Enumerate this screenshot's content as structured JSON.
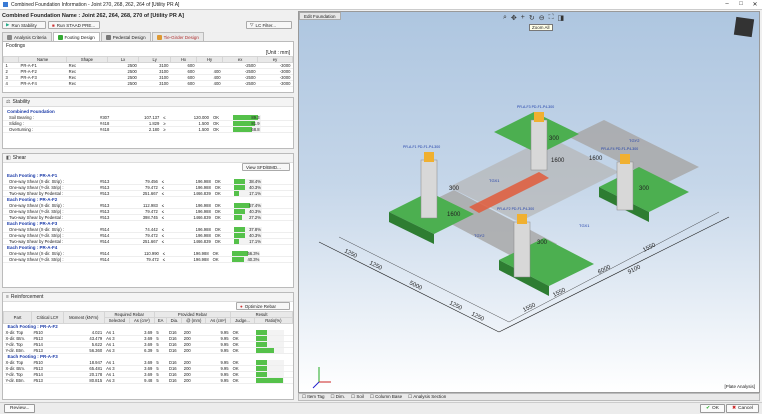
{
  "window": {
    "title": "Combined Foundation Information - Joint 270, 268, 262, 264 of [Utility PR A]"
  },
  "header": {
    "name": "Combined Foundation Name : Joint 262, 264, 268, 270 of [Utility PR A]"
  },
  "toolbar": {
    "run_stability": "Run Stability",
    "run_staad": "Run STAAD PRE...",
    "lc_filter": "LC Filter..."
  },
  "tabs": [
    "Analysis Criteria",
    "Footing Design",
    "Pedestal Design",
    "Tie-Girder Design"
  ],
  "footings": {
    "label": "Footings",
    "unit": "[Unit : mm]",
    "columns": [
      "",
      "Name",
      "Shape",
      "Lx",
      "Ly",
      "Hx",
      "Hy",
      "ex",
      "ey"
    ],
    "rows": [
      [
        "1",
        "PR-A-F1",
        "Rec",
        "2500",
        "3100",
        "600",
        "",
        "-2500",
        "-3000"
      ],
      [
        "2",
        "PR-A-F2",
        "Rec",
        "2500",
        "3100",
        "600",
        "400",
        "-2500",
        "-3000"
      ],
      [
        "3",
        "PR-A-F3",
        "Rec",
        "2500",
        "3100",
        "600",
        "400",
        "-2500",
        "-3000"
      ],
      [
        "4",
        "PR-A-F4",
        "Rec",
        "2500",
        "3100",
        "600",
        "400",
        "-2500",
        "-3000"
      ]
    ]
  },
  "stability": {
    "label": "Stability",
    "group": "Combined Foundation",
    "rows": [
      {
        "name": "Soil Bearing :",
        "lc": "#307",
        "val": "107.137",
        "op": "≤",
        "lim": "120.000",
        "st": "OK",
        "ratio": "89.3",
        "r": 0.893
      },
      {
        "name": "Sliding :",
        "lc": "#418",
        "val": "1.829",
        "op": "≥",
        "lim": "1.500",
        "st": "OK",
        "ratio": "81.9",
        "r": 0.819
      },
      {
        "name": "Overturning :",
        "lc": "#418",
        "val": "2.180",
        "op": "≥",
        "lim": "1.500",
        "st": "OK",
        "ratio": "68.8",
        "r": 0.688
      }
    ]
  },
  "shear": {
    "label": "Shear",
    "view_btn": "View SFD/BMD...",
    "groups": [
      {
        "title": "Each Footing : PR-A-F1",
        "rows": [
          {
            "name": "One-way Shear (X-dir. Strip) :",
            "lc": "#513",
            "val": "79.456",
            "op": "≤",
            "lim": "196.988",
            "st": "OK",
            "ratio": "38.4%",
            "r": 0.384
          },
          {
            "name": "One-way Shear (Y-dir. Strip) :",
            "lc": "#513",
            "val": "79.472",
            "op": "≤",
            "lim": "196.988",
            "st": "OK",
            "ratio": "40.3%",
            "r": 0.403
          },
          {
            "name": "Two-way Shear by Pedestal :",
            "lc": "#513",
            "val": "251.667",
            "op": "≤",
            "lim": "1466.839",
            "st": "OK",
            "ratio": "17.1%",
            "r": 0.171
          }
        ]
      },
      {
        "title": "Each Footing : PR-A-F2",
        "rows": [
          {
            "name": "One-way Shear (X-dir. Strip) :",
            "lc": "#513",
            "val": "112.983",
            "op": "≤",
            "lim": "196.988",
            "st": "OK",
            "ratio": "57.4%",
            "r": 0.574
          },
          {
            "name": "One-way Shear (Y-dir. Strip) :",
            "lc": "#513",
            "val": "79.472",
            "op": "≤",
            "lim": "196.988",
            "st": "OK",
            "ratio": "40.3%",
            "r": 0.403
          },
          {
            "name": "Two-way Shear by Pedestal :",
            "lc": "#513",
            "val": "398.745",
            "op": "≤",
            "lim": "1466.839",
            "st": "OK",
            "ratio": "27.2%",
            "r": 0.272
          }
        ]
      },
      {
        "title": "Each Footing : PR-A-F3",
        "rows": [
          {
            "name": "One-way Shear (X-dir. Strip) :",
            "lc": "#514",
            "val": "74.442",
            "op": "≤",
            "lim": "196.988",
            "st": "OK",
            "ratio": "37.8%",
            "r": 0.378
          },
          {
            "name": "One-way Shear (Y-dir. Strip) :",
            "lc": "#514",
            "val": "79.472",
            "op": "≤",
            "lim": "196.988",
            "st": "OK",
            "ratio": "40.3%",
            "r": 0.403
          },
          {
            "name": "Two-way Shear by Pedestal :",
            "lc": "#514",
            "val": "251.667",
            "op": "≤",
            "lim": "1466.839",
            "st": "OK",
            "ratio": "17.1%",
            "r": 0.171
          }
        ]
      },
      {
        "title": "Each Footing : PR-A-F4",
        "rows": [
          {
            "name": "One-way Shear (X-dir. Strip) :",
            "lc": "#514",
            "val": "110.990",
            "op": "≤",
            "lim": "196.988",
            "st": "OK",
            "ratio": "56.3%",
            "r": 0.563
          },
          {
            "name": "One-way Shear (Y-dir. Strip) :",
            "lc": "#514",
            "val": "79.472",
            "op": "≤",
            "lim": "196.988",
            "st": "OK",
            "ratio": "40.3%",
            "r": 0.403
          }
        ]
      }
    ]
  },
  "reinforcement": {
    "label": "Reinforcement",
    "optimize_btn": "Optimize Rebar",
    "head1": [
      "Part",
      "Critical LC#",
      "Moment (kN*m)",
      "Required Rebar",
      "Provided Rebar",
      "Result"
    ],
    "head2": [
      "Selected",
      "As (cm²)",
      "EA",
      "Dia.",
      "@ (mm)",
      "As (cm²)",
      "Judge...",
      "Ratio(%)"
    ],
    "groups": [
      {
        "title": "Each Footing : PR-A-F2",
        "rows": [
          {
            "part": "X-dir. Top",
            "lc": "#510",
            "m": "4.021",
            "sel": "As 1",
            "as": "3.69",
            "ea": "5",
            "dia": "D16",
            "at": "200",
            "pas": "9.95",
            "j": "OK",
            "r": 0.37
          },
          {
            "part": "X-dir. Btm.",
            "lc": "#513",
            "m": "43.479",
            "sel": "As 3",
            "as": "3.69",
            "ea": "5",
            "dia": "D16",
            "at": "200",
            "pas": "9.95",
            "j": "OK",
            "r": 0.37
          },
          {
            "part": "Y-dir. Top",
            "lc": "#514",
            "m": "5.622",
            "sel": "As 1",
            "as": "3.69",
            "ea": "5",
            "dia": "D16",
            "at": "200",
            "pas": "9.95",
            "j": "OK",
            "r": 0.37
          },
          {
            "part": "Y-dir. Btm.",
            "lc": "#513",
            "m": "56.360",
            "sel": "As 3",
            "as": "6.39",
            "ea": "5",
            "dia": "D16",
            "at": "200",
            "pas": "9.95",
            "j": "OK",
            "r": 0.64
          }
        ]
      },
      {
        "title": "Each Footing : PR-A-F3",
        "rows": [
          {
            "part": "X-dir. Top",
            "lc": "#510",
            "m": "18.947",
            "sel": "As 1",
            "as": "3.69",
            "ea": "5",
            "dia": "D16",
            "at": "200",
            "pas": "9.95",
            "j": "OK",
            "r": 0.37
          },
          {
            "part": "X-dir. Btm.",
            "lc": "#513",
            "m": "65.481",
            "sel": "As 3",
            "as": "3.69",
            "ea": "5",
            "dia": "D16",
            "at": "200",
            "pas": "9.95",
            "j": "OK",
            "r": 0.37
          },
          {
            "part": "Y-dir. Top",
            "lc": "#514",
            "m": "20.178",
            "sel": "As 1",
            "as": "3.69",
            "ea": "5",
            "dia": "D16",
            "at": "200",
            "pas": "9.95",
            "j": "OK",
            "r": 0.37
          },
          {
            "part": "Y-dir. Btm.",
            "lc": "#513",
            "m": "80.815",
            "sel": "As 3",
            "as": "9.48",
            "ea": "5",
            "dia": "D16",
            "at": "200",
            "pas": "9.95",
            "j": "OK",
            "r": 0.95
          }
        ]
      }
    ]
  },
  "viewport": {
    "tab": "Edit Foundation",
    "tooltip": "Zoom All",
    "status": "[Plate Analysis]",
    "dims": [
      "1250",
      "1250",
      "5000",
      "1250",
      "1250",
      "1250",
      "1550",
      "1550",
      "6000",
      "1550",
      "9100",
      "300",
      "1600",
      "300",
      "1600",
      "300",
      "1600",
      "1600",
      "300"
    ],
    "beam_labels": [
      "TGX1",
      "TGY2",
      "TGX1",
      "TGY2"
    ],
    "pedestal_labels": [
      "PR-A-F1 PD-F1-P4-300",
      "PR-A-F2 PD-F1-P4-300",
      "PR-A-F3 PD-F1-P4-300",
      "PR-A-F4 PD-F1-P4-300"
    ]
  },
  "bottombar": [
    "Item Tag",
    "Dim.",
    "Soil",
    "Column Base",
    "Analysis Section"
  ],
  "footer": {
    "review": "Review...",
    "ok": "OK",
    "cancel": "Cancel"
  },
  "colors": {
    "green": "#55c14a",
    "blue_text": "#1a3aa8",
    "footing_green": "#4caf50"
  }
}
